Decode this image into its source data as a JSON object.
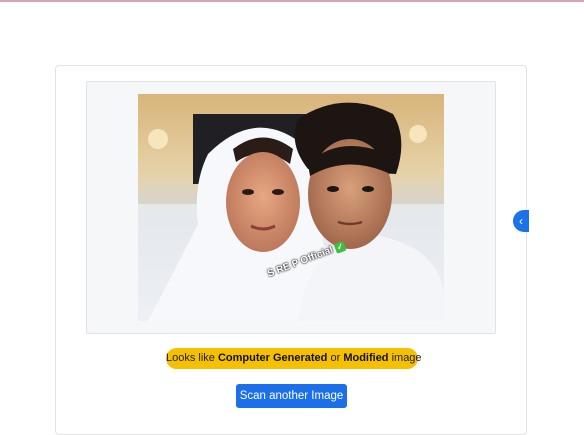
{
  "result": {
    "verdict_prefix": "Looks like ",
    "verdict_term1": "Computer Generated",
    "verdict_join": " or ",
    "verdict_term2": "Modified",
    "verdict_suffix": " image",
    "verdict_color": "#f5c000"
  },
  "image": {
    "watermark_text": "S RE P Official",
    "watermark_badge": "✓"
  },
  "actions": {
    "scan_again_label": "Scan another Image",
    "scan_again_color": "#1b6fe8",
    "carousel_prev_icon": "chevron-left-icon",
    "carousel_prev_glyph": "‹"
  }
}
